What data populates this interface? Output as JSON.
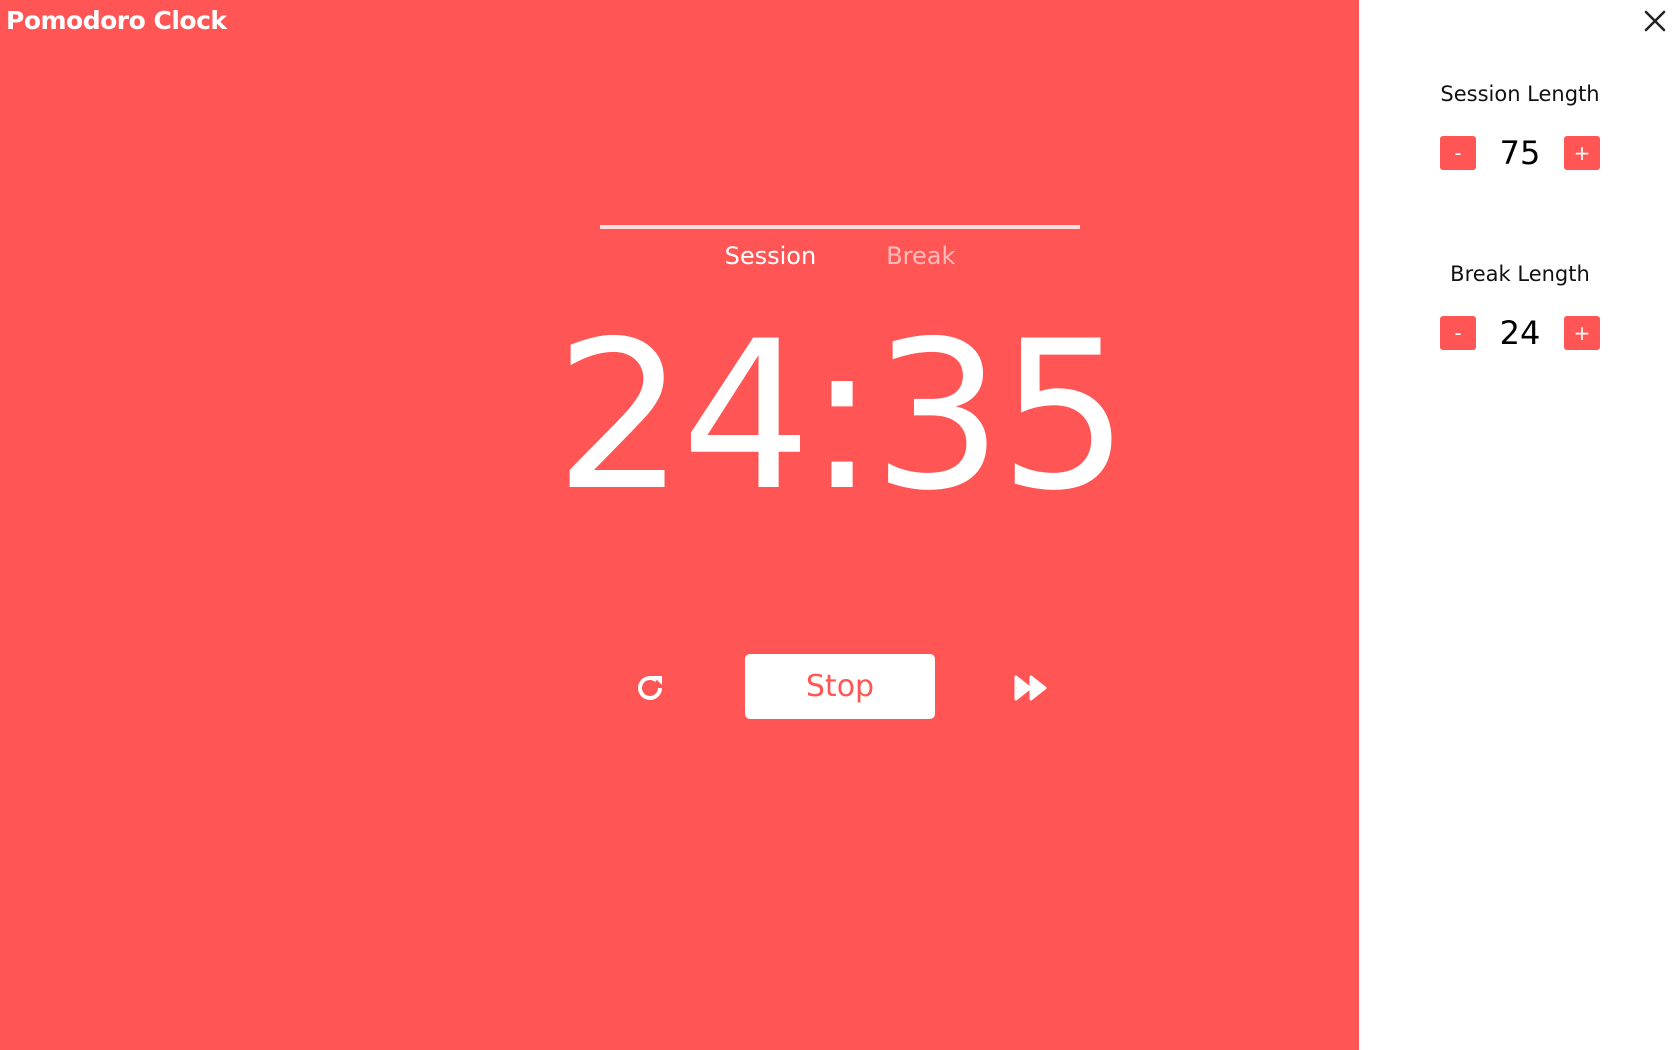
{
  "app": {
    "title": "Pomodoro Clock"
  },
  "modes": [
    {
      "label": "Session",
      "active": true
    },
    {
      "label": "Break",
      "active": false
    }
  ],
  "timer": {
    "display": "24:35"
  },
  "controls": {
    "restart_icon": "restart-icon",
    "stop_label": "Stop",
    "skip_icon": "fast-forward-icon"
  },
  "settings": {
    "session": {
      "label": "Session Length",
      "value": "75",
      "minus": "-",
      "plus": "+"
    },
    "break": {
      "label": "Break Length",
      "value": "24",
      "minus": "-",
      "plus": "+"
    }
  },
  "colors": {
    "accent": "#ff5555",
    "panel": "#ffffff"
  }
}
